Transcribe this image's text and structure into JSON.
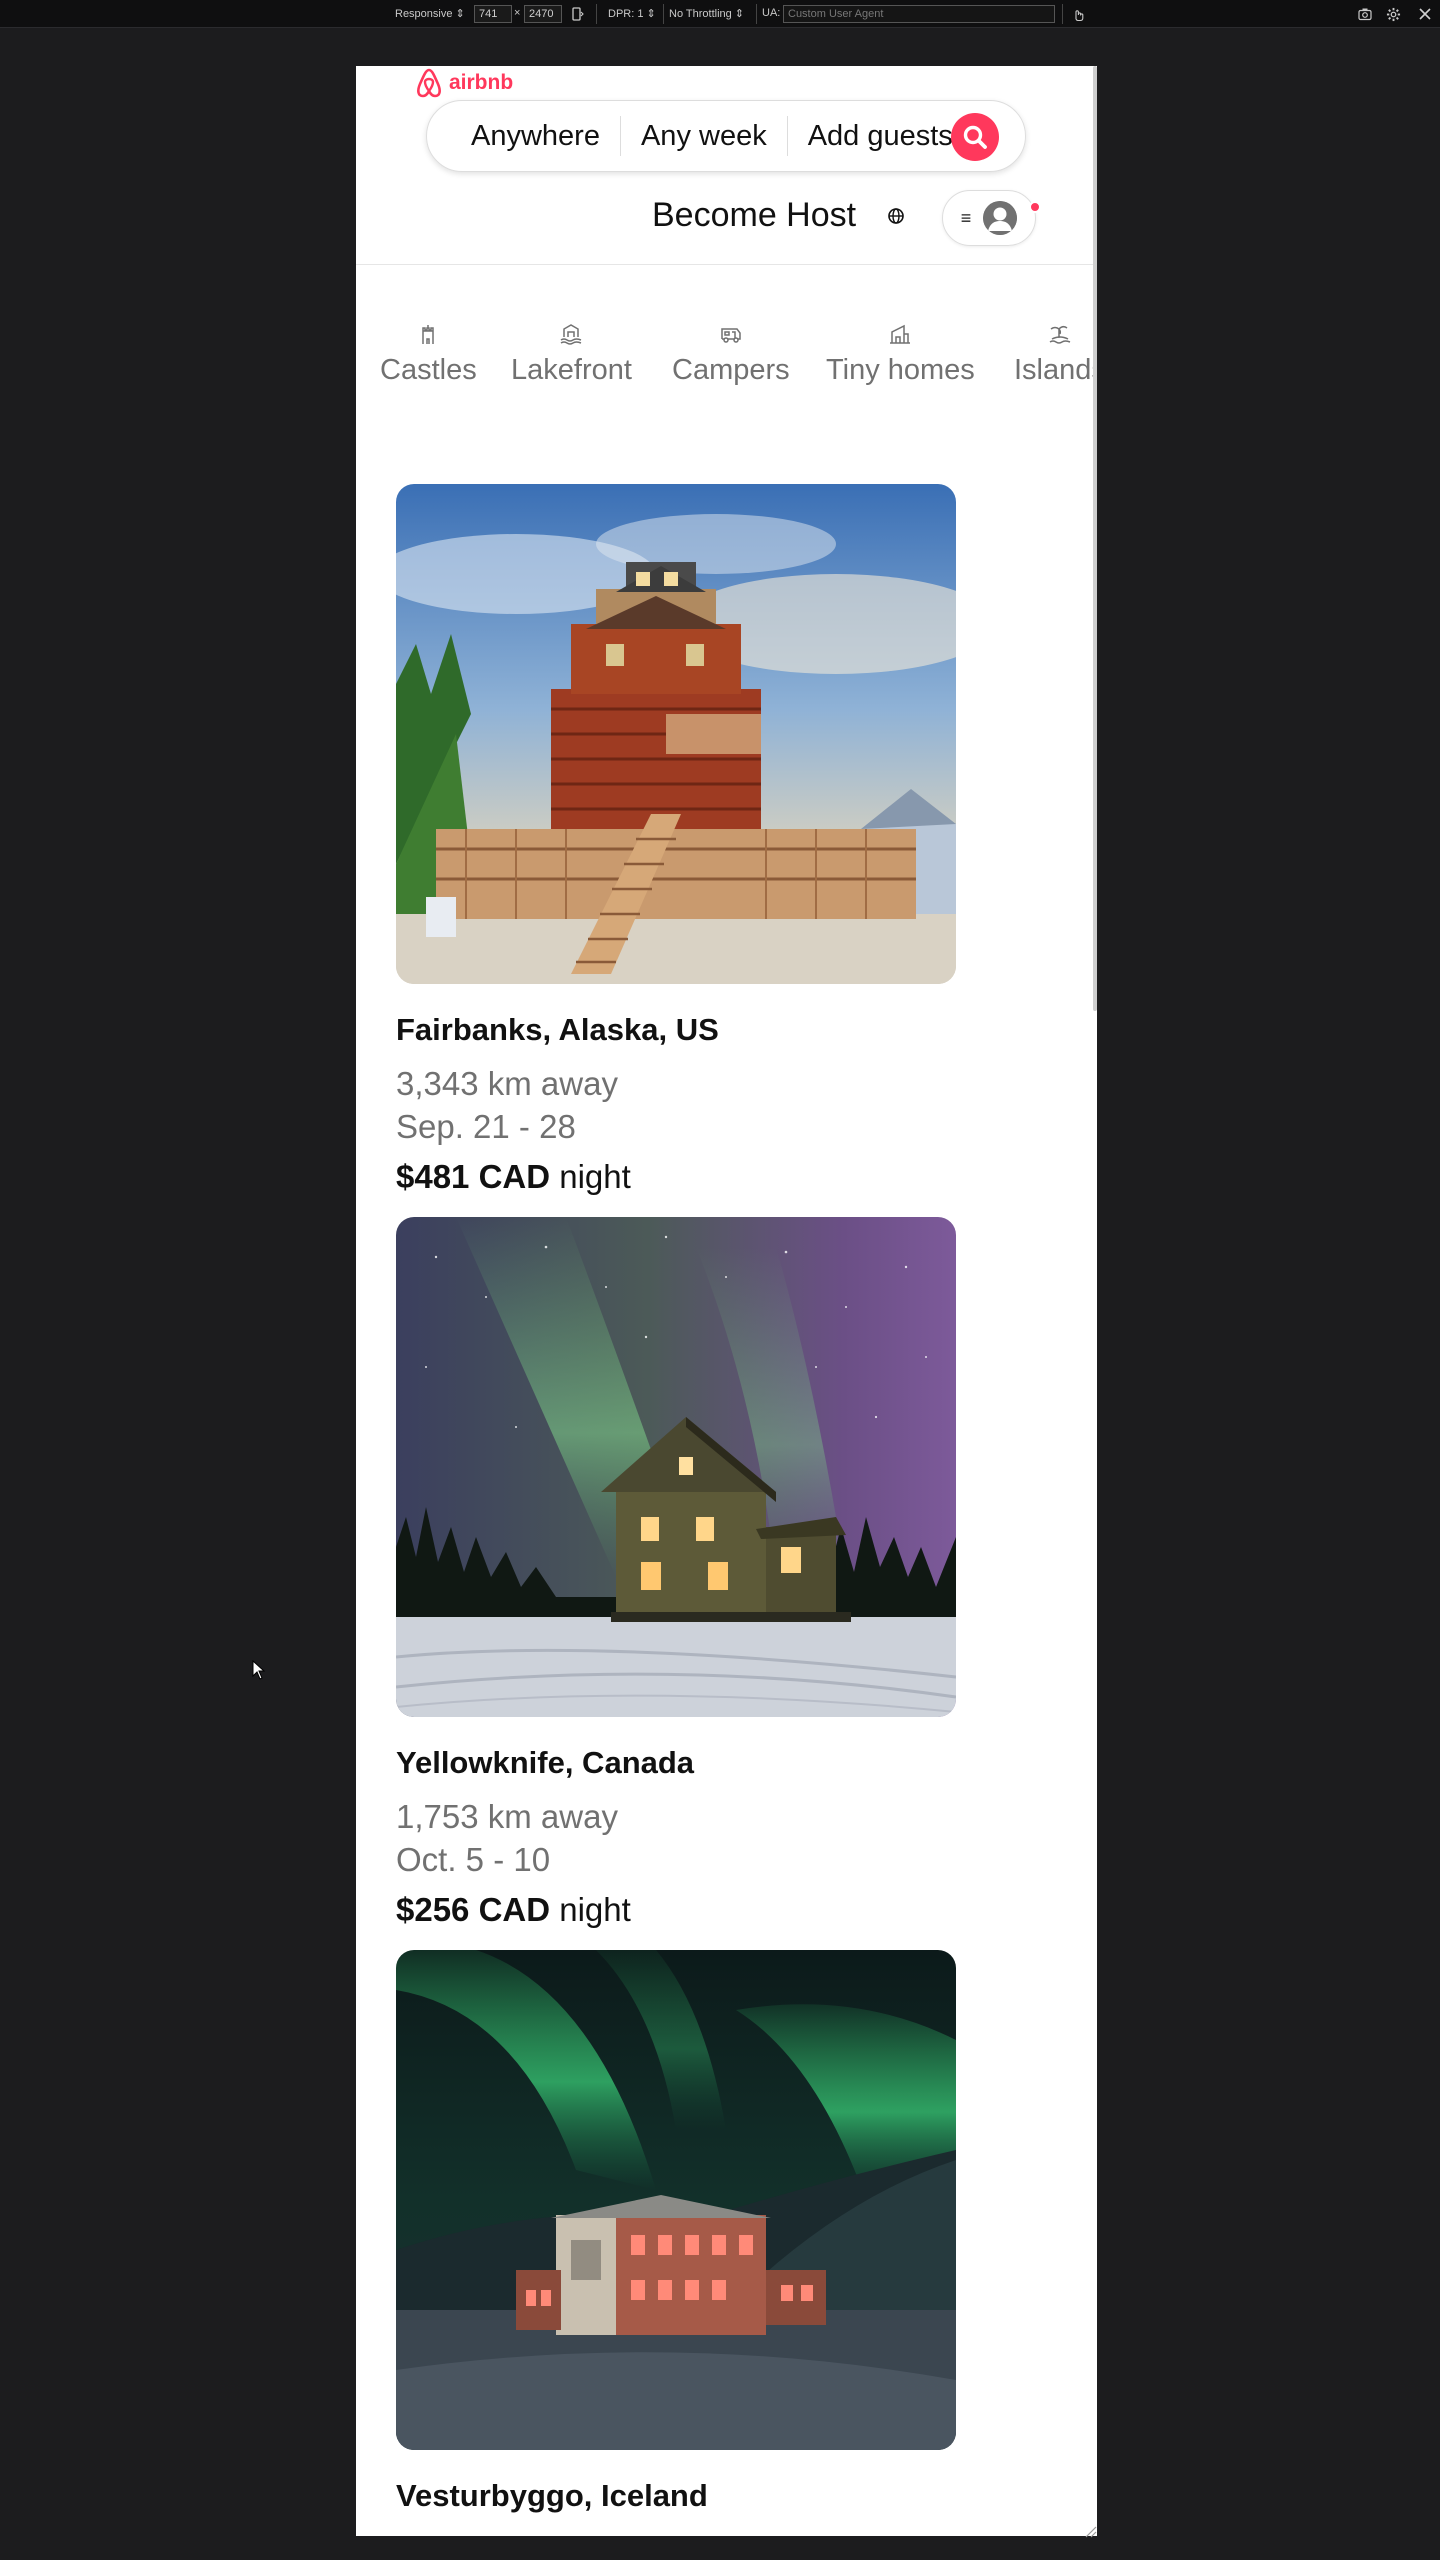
{
  "devtools": {
    "device": "Responsive",
    "width": "741",
    "times": "×",
    "height": "2470",
    "dpr": "DPR: 1",
    "throttling": "No Throttling",
    "ua_label": "UA:",
    "ua_placeholder": "Custom User Agent"
  },
  "header": {
    "logo_text": "airbnb",
    "search": {
      "where": "Anywhere",
      "when": "Any week",
      "guests": "Add guests"
    },
    "become_host": "Become Host",
    "menu_glyph": "≡"
  },
  "colors": {
    "brand": "#ff385c",
    "text": "#111111",
    "muted": "#717171"
  },
  "categories": [
    {
      "label": "Castles",
      "icon": "castle-icon"
    },
    {
      "label": "Lakefront",
      "icon": "lakefront-icon"
    },
    {
      "label": "Campers",
      "icon": "camper-icon"
    },
    {
      "label": "Tiny homes",
      "icon": "tiny-home-icon"
    },
    {
      "label": "Islands",
      "icon": "island-icon"
    }
  ],
  "listings": [
    {
      "location": "Fairbanks, Alaska, US",
      "distance": "3,343 km away",
      "dates": "Sep. 21 - 28",
      "price": "$481 CAD",
      "price_unit": "night"
    },
    {
      "location": "Yellowknife, Canada",
      "distance": "1,753 km away",
      "dates": "Oct. 5 - 10",
      "price": "$256 CAD",
      "price_unit": "night"
    },
    {
      "location": "Vesturbyggo, Iceland"
    }
  ]
}
